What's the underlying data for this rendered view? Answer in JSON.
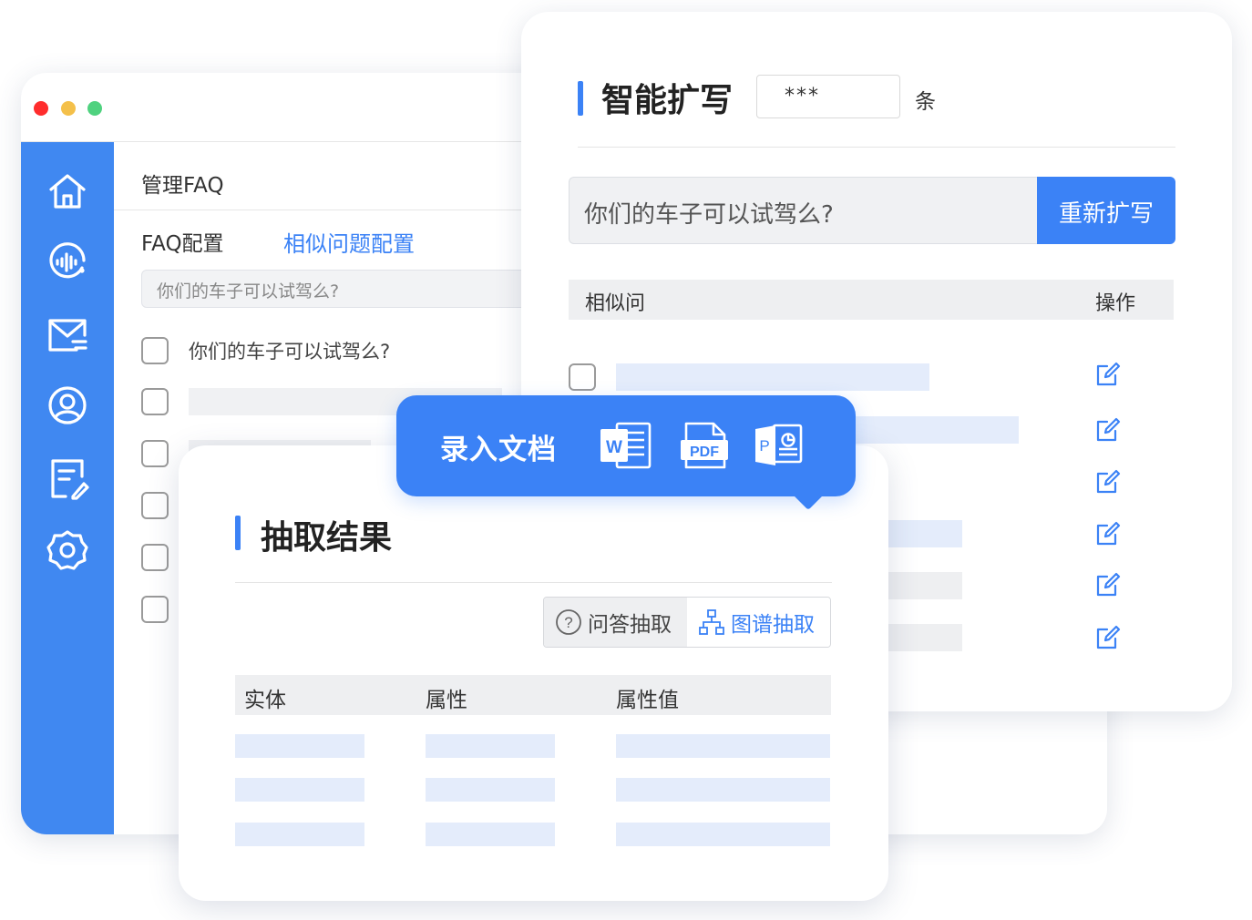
{
  "faq_window": {
    "title": "管理FAQ",
    "tab_faq": "FAQ配置",
    "tab_similar": "相似问题配置",
    "search_placeholder": "你们的车子可以试驾么?",
    "first_row": "你们的车子可以试驾么?",
    "sidebar_icons": [
      "home-icon",
      "voice-icon",
      "mail-icon",
      "user-icon",
      "document-edit-icon",
      "settings-icon"
    ]
  },
  "expand_panel": {
    "title": "智能扩写",
    "count_value": "***",
    "count_unit": "条",
    "query": "你们的车子可以试驾么?",
    "rewrite_button": "重新扩写",
    "col_similar": "相似问",
    "col_action": "操作"
  },
  "popup": {
    "label": "录入文档",
    "doc_icons": [
      "word-icon",
      "pdf-icon",
      "ppt-icon"
    ]
  },
  "extract_panel": {
    "title": "抽取结果",
    "seg_qa": "问答抽取",
    "seg_graph": "图谱抽取",
    "col_entity": "实体",
    "col_attr": "属性",
    "col_attr_value": "属性值"
  },
  "colors": {
    "primary": "#3b82f6",
    "sidebar": "#4088f1",
    "placeholder_bar": "#e4ecfb",
    "gray_bar": "#eeeff1"
  }
}
